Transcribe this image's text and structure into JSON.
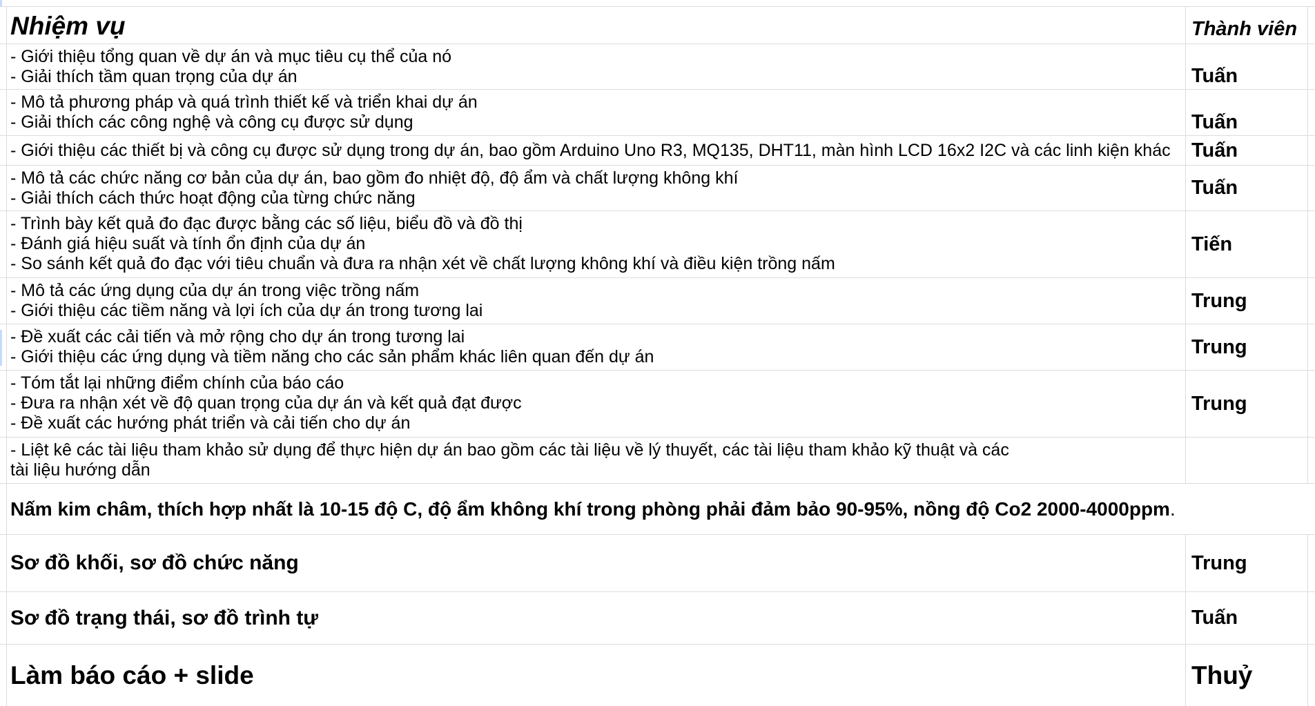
{
  "header": {
    "task": "Nhiệm vụ",
    "member": "Thành viên"
  },
  "rows": [
    {
      "lines": [
        "- Giới thiệu tổng quan về dự án và mục tiêu cụ thể của nó",
        "- Giải thích tầm quan trọng của dự án"
      ],
      "member": "Tuấn"
    },
    {
      "lines": [
        "- Mô tả phương pháp và quá trình thiết kế và triển khai dự án",
        "- Giải thích các công nghệ và công cụ được sử dụng"
      ],
      "member": "Tuấn"
    },
    {
      "lines": [
        "- Giới thiệu các thiết bị và công cụ được sử dụng trong dự án, bao gồm Arduino Uno R3, MQ135, DHT11, màn hình LCD 16x2 I2C và các linh kiện khác"
      ],
      "member": "Tuấn"
    },
    {
      "lines": [
        "- Mô tả các chức năng cơ bản của dự án, bao gồm đo nhiệt độ, độ ẩm và chất lượng không khí",
        "- Giải thích cách thức hoạt động của từng chức năng"
      ],
      "member": "Tuấn"
    },
    {
      "lines": [
        "- Trình bày kết quả đo đạc được bằng các số liệu, biểu đồ và đồ thị",
        "- Đánh giá hiệu suất và tính ổn định của dự án",
        "- So sánh kết quả đo đạc với tiêu chuẩn và đưa ra nhận xét về chất lượng không khí và điều kiện trồng nấm"
      ],
      "member": "Tiến"
    },
    {
      "lines": [
        "- Mô tả các ứng dụng của dự án trong việc trồng nấm",
        "- Giới thiệu các tiềm năng và lợi ích của dự án trong tương lai"
      ],
      "member": "Trung"
    },
    {
      "lines": [
        "- Đề xuất các cải tiến và mở rộng cho dự án trong tương lai",
        "- Giới thiệu các ứng dụng và tiềm năng cho các sản phẩm khác liên quan đến dự án"
      ],
      "member": "Trung"
    },
    {
      "lines": [
        "- Tóm tắt lại những điểm chính của báo cáo",
        "- Đưa ra nhận xét về độ quan trọng của dự án và kết quả đạt được",
        "- Đề xuất các hướng phát triển và cải tiến cho dự án"
      ],
      "member": "Trung"
    },
    {
      "lines": [
        "- Liệt kê các tài liệu tham khảo sử dụng để thực hiện dự án bao gồm các tài liệu về lý thuyết, các tài liệu tham khảo kỹ thuật và các",
        "tài liệu hướng dẫn"
      ],
      "member": ""
    }
  ],
  "note": {
    "bold": "Nấm kim châm, thích hợp nhất là 10-15 độ C, độ ẩm không khí trong phòng phải đảm bảo 90-95%, nồng độ Co2 2000-4000ppm",
    "tail": "."
  },
  "sections": [
    {
      "task": "Sơ đồ khối, sơ đồ chức năng",
      "member": "Trung"
    },
    {
      "task": "Sơ đồ trạng thái, sơ đồ trình tự",
      "member": "Tuấn"
    }
  ],
  "final": {
    "task": "Làm báo cáo + slide",
    "member": "Thuỷ"
  },
  "colors": {
    "gridline": "#dadce0",
    "text": "#000000",
    "background": "#ffffff"
  }
}
